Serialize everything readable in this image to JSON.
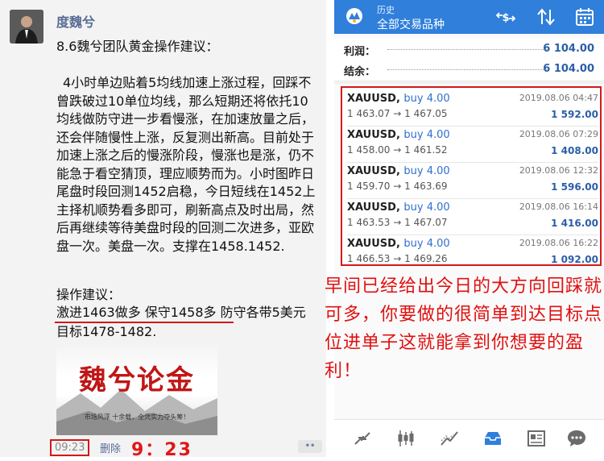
{
  "wechat": {
    "username": "度魏兮",
    "title": "8.6魏兮团队黄金操作建议：",
    "body": "4小时单边贴着5均线加速上涨过程，回踩不曾跌破过10单位均线，那么短期还将依托10均线做防守进一步看慢涨，在加速放量之后，还会伴随慢性上涨，反复测出新高。目前处于加速上涨之后的慢涨阶段，慢涨也是涨，仍不能急于看空猜顶，理应顺势而为。小时图昨日尾盘时段回测1452启稳，今日短线在1452上主择机顺势看多即可，刷新高点及时出局，然后再继续等待美盘时段的回测二次进多，亚欧盘一次。美盘一次。支撑在1458.1452.",
    "advice_label": "操作建议：",
    "advice_highlight": "激进1463做多 保守1458多",
    "advice_rest": " 防守各带5美元 目标1478-1482.",
    "poster_title": "魏兮论金",
    "poster_sub": "市场风浮 十余载，全凭实力夺头筹！",
    "time": "09:23",
    "delete_label": "删除",
    "time_big": "9：23",
    "more_label": "••",
    "accent_red": "#d31919",
    "link_blue": "#576b95"
  },
  "mt4": {
    "header_small": "历史",
    "header_main": "全部交易品种",
    "profit_label": "利润：",
    "profit_value": "6 104.00",
    "balance_label": "结余：",
    "balance_value": "6 104.00",
    "trades": [
      {
        "symbol": "XAUUSD,",
        "side": "buy 4.00",
        "prices": "1 463.07 → 1 467.05",
        "date": "2019.08.06 04:47",
        "profit": "1 592.00"
      },
      {
        "symbol": "XAUUSD,",
        "side": "buy 4.00",
        "prices": "1 458.00 → 1 461.52",
        "date": "2019.08.06 07:29",
        "profit": "1 408.00"
      },
      {
        "symbol": "XAUUSD,",
        "side": "buy 4.00",
        "prices": "1 459.70 → 1 463.69",
        "date": "2019.08.06 12:32",
        "profit": "1 596.00"
      },
      {
        "symbol": "XAUUSD,",
        "side": "buy 4.00",
        "prices": "1 463.53 → 1 467.07",
        "date": "2019.08.06 16:14",
        "profit": "1 416.00"
      },
      {
        "symbol": "XAUUSD,",
        "side": "buy 4.00",
        "prices": "1 466.53 → 1 469.26",
        "date": "2019.08.06 16:22",
        "profit": "1 092.00"
      }
    ],
    "toolbar_icons": [
      "dollar-arrows-icon",
      "sort-icon",
      "calendar-icon"
    ],
    "bottom_icons": [
      "quotes-icon",
      "chart-icon",
      "trade-icon",
      "history-icon",
      "news-icon",
      "chat-icon"
    ],
    "header_color": "#2f7fdb",
    "profit_color": "#2b5ea8"
  },
  "note": "早间已经给出今日的大方向回踩就可多，你要做的很简单到达目标点位进单子这就能拿到你想要的盈利！"
}
